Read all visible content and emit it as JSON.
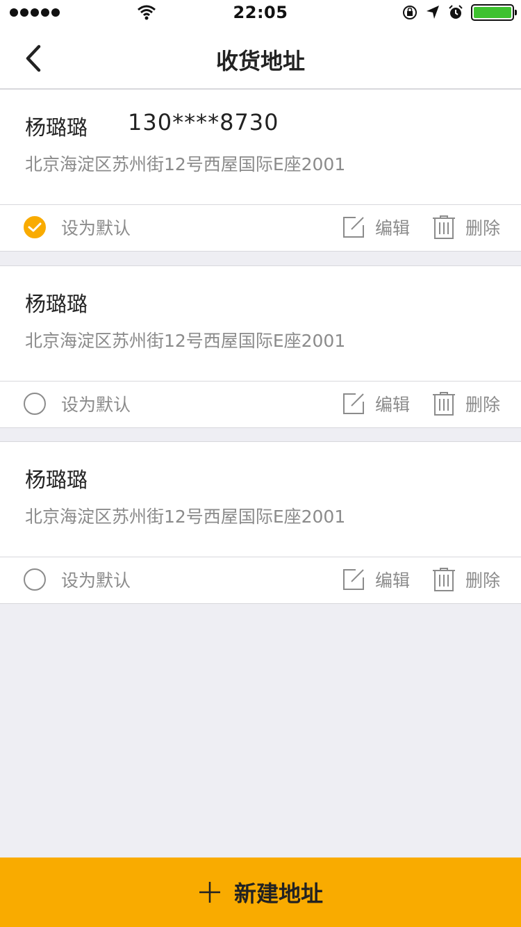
{
  "status_bar": {
    "time": "22:05",
    "signal_dots": 5,
    "battery_color": "#3ec230",
    "icons": [
      "signal-icon",
      "wifi-icon",
      "rotation-lock-icon",
      "location-icon",
      "alarm-icon",
      "battery-icon"
    ]
  },
  "nav": {
    "title": "收货地址",
    "back_icon": "chevron-left-icon"
  },
  "addresses": [
    {
      "name": "杨璐璐",
      "phone": "130****8730",
      "address": "北京海淀区苏州街12号西屋国际E座2001",
      "is_default": true,
      "default_label": "设为默认",
      "edit_label": "编辑",
      "delete_label": "删除"
    },
    {
      "name": "杨璐璐",
      "phone": "",
      "address": "北京海淀区苏州街12号西屋国际E座2001",
      "is_default": false,
      "default_label": "设为默认",
      "edit_label": "编辑",
      "delete_label": "删除"
    },
    {
      "name": "杨璐璐",
      "phone": "",
      "address": "北京海淀区苏州街12号西屋国际E座2001",
      "is_default": false,
      "default_label": "设为默认",
      "edit_label": "编辑",
      "delete_label": "删除"
    }
  ],
  "footer": {
    "new_address_label": "新建地址",
    "plus_icon": "plus-icon"
  },
  "colors": {
    "accent": "#f9ab00",
    "background": "#eeeef3",
    "text_secondary": "#8b8b8b"
  }
}
